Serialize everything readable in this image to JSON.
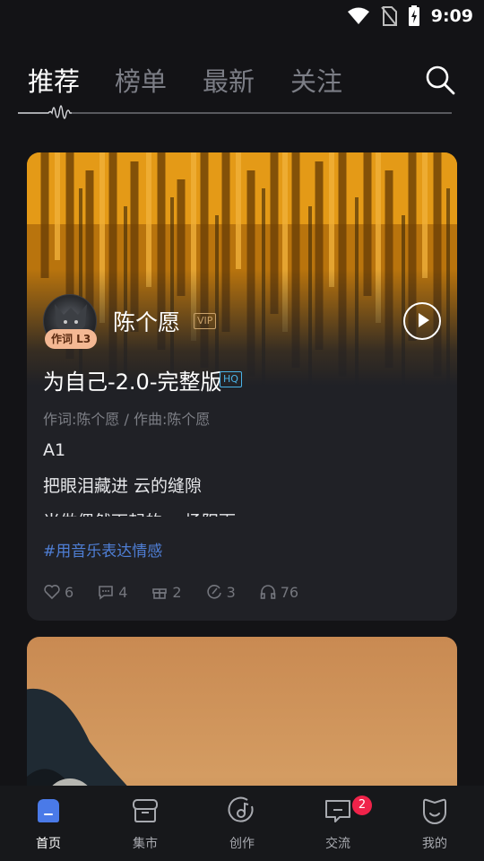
{
  "status_bar": {
    "time": "9:09",
    "icons": [
      "wifi-icon",
      "no-sim-icon",
      "battery-charging-icon"
    ]
  },
  "top_nav": {
    "tabs": [
      {
        "label": "推荐",
        "active": true
      },
      {
        "label": "榜单",
        "active": false
      },
      {
        "label": "最新",
        "active": false
      },
      {
        "label": "关注",
        "active": false
      }
    ],
    "search_icon": "search-icon"
  },
  "feed": [
    {
      "author": {
        "name": "陈个愿",
        "level_badge": "作词 L3",
        "vip_label": "VIP"
      },
      "title": "为自己-2.0-完整版",
      "quality_label": "HQ",
      "credits": "作词:陈个愿 / 作曲:陈个愿",
      "lyrics": [
        "A1",
        "把眼泪藏进 云的缝隙",
        "当做偶然下起的 一场阳雨"
      ],
      "hashtag": "#用音乐表达情感",
      "stats": {
        "likes": "6",
        "comments": "4",
        "gifts": "2",
        "shares": "3",
        "listens": "76"
      }
    }
  ],
  "bottom_nav": {
    "items": [
      {
        "label": "首页",
        "icon": "home-icon",
        "active": true
      },
      {
        "label": "集市",
        "icon": "market-icon",
        "active": false
      },
      {
        "label": "创作",
        "icon": "create-icon",
        "active": false
      },
      {
        "label": "交流",
        "icon": "chat-icon",
        "active": false,
        "badge": "2"
      },
      {
        "label": "我的",
        "icon": "profile-icon",
        "active": false
      }
    ]
  },
  "colors": {
    "accent": "#4a7ae8",
    "badge_red": "#f0234a",
    "hashtag": "#4f7fd6"
  }
}
